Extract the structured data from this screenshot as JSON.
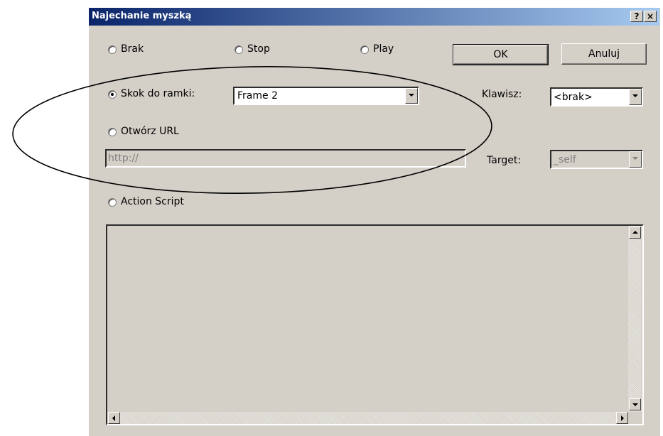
{
  "window": {
    "title": "Najechanie myszką"
  },
  "titlebar_buttons": {
    "help": "?",
    "close": "×"
  },
  "radios": {
    "brak": "Brak",
    "stop": "Stop",
    "play": "Play",
    "skok": "Skok do ramki:",
    "url": "Otwórz URL",
    "script": "Action Script"
  },
  "selected_radio": "skok",
  "buttons": {
    "ok": "OK",
    "cancel": "Anuluj"
  },
  "frame_select": {
    "value": "Frame 2"
  },
  "key": {
    "label": "Klawisz:",
    "value": "<brak>"
  },
  "url": {
    "value": "http://"
  },
  "target": {
    "label": "Target:",
    "value": "_self"
  },
  "colors": {
    "dialog_bg": "#d4d0c8",
    "titlebar_start": "#0a246a",
    "titlebar_end": "#a6caf0"
  }
}
